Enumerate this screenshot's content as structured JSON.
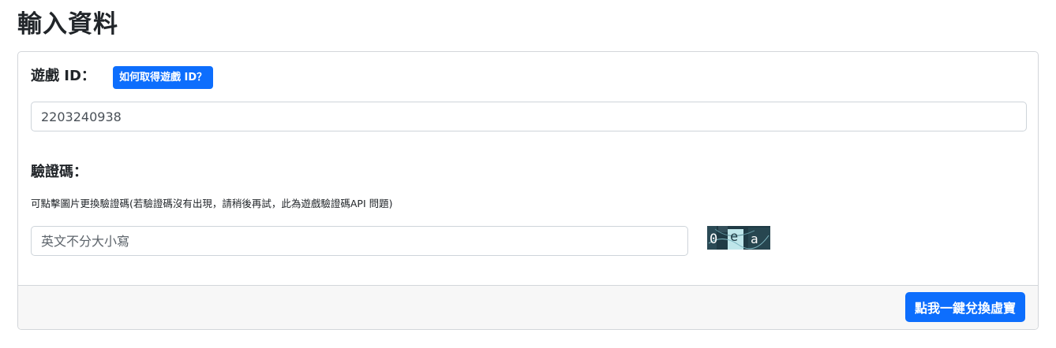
{
  "page": {
    "title": "輸入資料"
  },
  "form": {
    "game_id": {
      "label": "遊戲 ID：",
      "help_button": "如何取得遊戲 ID？",
      "value": "2203240938"
    },
    "captcha": {
      "label": "驗證碼：",
      "hint": "可點擊圖片更換驗證碼(若驗證碼沒有出現，請稍後再試，此為遊戲驗證碼API 問題)",
      "placeholder": "英文不分大小寫",
      "image_text": "0ea"
    },
    "submit_label": "點我一鍵兌換虛寶"
  },
  "colors": {
    "primary": "#0d6efd",
    "footer_bg": "#f7f7f7",
    "border": "#d3d6da",
    "captcha_dark": "#1f3a44",
    "captcha_light": "#bfe6ea"
  }
}
